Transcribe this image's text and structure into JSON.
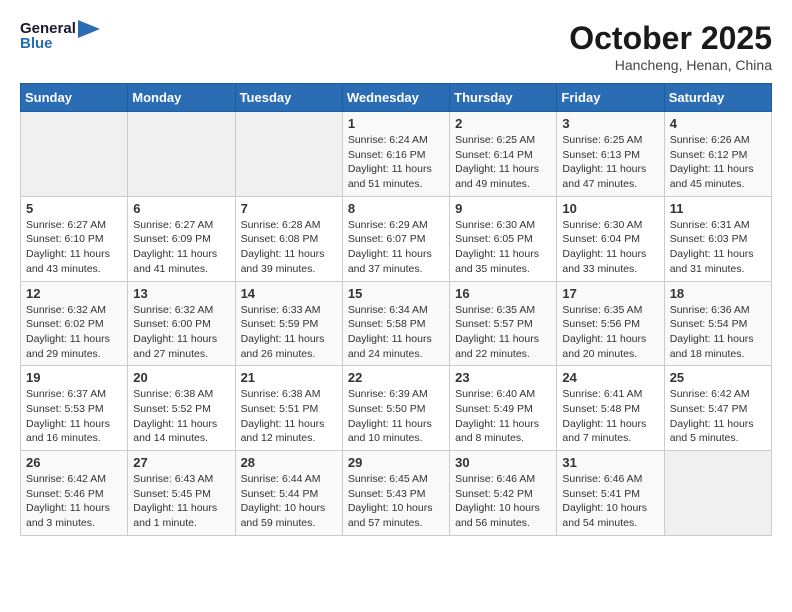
{
  "logo": {
    "line1": "General",
    "line2": "Blue"
  },
  "title": "October 2025",
  "location": "Hancheng, Henan, China",
  "days_header": [
    "Sunday",
    "Monday",
    "Tuesday",
    "Wednesday",
    "Thursday",
    "Friday",
    "Saturday"
  ],
  "weeks": [
    [
      {
        "day": "",
        "info": ""
      },
      {
        "day": "",
        "info": ""
      },
      {
        "day": "",
        "info": ""
      },
      {
        "day": "1",
        "info": "Sunrise: 6:24 AM\nSunset: 6:16 PM\nDaylight: 11 hours\nand 51 minutes."
      },
      {
        "day": "2",
        "info": "Sunrise: 6:25 AM\nSunset: 6:14 PM\nDaylight: 11 hours\nand 49 minutes."
      },
      {
        "day": "3",
        "info": "Sunrise: 6:25 AM\nSunset: 6:13 PM\nDaylight: 11 hours\nand 47 minutes."
      },
      {
        "day": "4",
        "info": "Sunrise: 6:26 AM\nSunset: 6:12 PM\nDaylight: 11 hours\nand 45 minutes."
      }
    ],
    [
      {
        "day": "5",
        "info": "Sunrise: 6:27 AM\nSunset: 6:10 PM\nDaylight: 11 hours\nand 43 minutes."
      },
      {
        "day": "6",
        "info": "Sunrise: 6:27 AM\nSunset: 6:09 PM\nDaylight: 11 hours\nand 41 minutes."
      },
      {
        "day": "7",
        "info": "Sunrise: 6:28 AM\nSunset: 6:08 PM\nDaylight: 11 hours\nand 39 minutes."
      },
      {
        "day": "8",
        "info": "Sunrise: 6:29 AM\nSunset: 6:07 PM\nDaylight: 11 hours\nand 37 minutes."
      },
      {
        "day": "9",
        "info": "Sunrise: 6:30 AM\nSunset: 6:05 PM\nDaylight: 11 hours\nand 35 minutes."
      },
      {
        "day": "10",
        "info": "Sunrise: 6:30 AM\nSunset: 6:04 PM\nDaylight: 11 hours\nand 33 minutes."
      },
      {
        "day": "11",
        "info": "Sunrise: 6:31 AM\nSunset: 6:03 PM\nDaylight: 11 hours\nand 31 minutes."
      }
    ],
    [
      {
        "day": "12",
        "info": "Sunrise: 6:32 AM\nSunset: 6:02 PM\nDaylight: 11 hours\nand 29 minutes."
      },
      {
        "day": "13",
        "info": "Sunrise: 6:32 AM\nSunset: 6:00 PM\nDaylight: 11 hours\nand 27 minutes."
      },
      {
        "day": "14",
        "info": "Sunrise: 6:33 AM\nSunset: 5:59 PM\nDaylight: 11 hours\nand 26 minutes."
      },
      {
        "day": "15",
        "info": "Sunrise: 6:34 AM\nSunset: 5:58 PM\nDaylight: 11 hours\nand 24 minutes."
      },
      {
        "day": "16",
        "info": "Sunrise: 6:35 AM\nSunset: 5:57 PM\nDaylight: 11 hours\nand 22 minutes."
      },
      {
        "day": "17",
        "info": "Sunrise: 6:35 AM\nSunset: 5:56 PM\nDaylight: 11 hours\nand 20 minutes."
      },
      {
        "day": "18",
        "info": "Sunrise: 6:36 AM\nSunset: 5:54 PM\nDaylight: 11 hours\nand 18 minutes."
      }
    ],
    [
      {
        "day": "19",
        "info": "Sunrise: 6:37 AM\nSunset: 5:53 PM\nDaylight: 11 hours\nand 16 minutes."
      },
      {
        "day": "20",
        "info": "Sunrise: 6:38 AM\nSunset: 5:52 PM\nDaylight: 11 hours\nand 14 minutes."
      },
      {
        "day": "21",
        "info": "Sunrise: 6:38 AM\nSunset: 5:51 PM\nDaylight: 11 hours\nand 12 minutes."
      },
      {
        "day": "22",
        "info": "Sunrise: 6:39 AM\nSunset: 5:50 PM\nDaylight: 11 hours\nand 10 minutes."
      },
      {
        "day": "23",
        "info": "Sunrise: 6:40 AM\nSunset: 5:49 PM\nDaylight: 11 hours\nand 8 minutes."
      },
      {
        "day": "24",
        "info": "Sunrise: 6:41 AM\nSunset: 5:48 PM\nDaylight: 11 hours\nand 7 minutes."
      },
      {
        "day": "25",
        "info": "Sunrise: 6:42 AM\nSunset: 5:47 PM\nDaylight: 11 hours\nand 5 minutes."
      }
    ],
    [
      {
        "day": "26",
        "info": "Sunrise: 6:42 AM\nSunset: 5:46 PM\nDaylight: 11 hours\nand 3 minutes."
      },
      {
        "day": "27",
        "info": "Sunrise: 6:43 AM\nSunset: 5:45 PM\nDaylight: 11 hours\nand 1 minute."
      },
      {
        "day": "28",
        "info": "Sunrise: 6:44 AM\nSunset: 5:44 PM\nDaylight: 10 hours\nand 59 minutes."
      },
      {
        "day": "29",
        "info": "Sunrise: 6:45 AM\nSunset: 5:43 PM\nDaylight: 10 hours\nand 57 minutes."
      },
      {
        "day": "30",
        "info": "Sunrise: 6:46 AM\nSunset: 5:42 PM\nDaylight: 10 hours\nand 56 minutes."
      },
      {
        "day": "31",
        "info": "Sunrise: 6:46 AM\nSunset: 5:41 PM\nDaylight: 10 hours\nand 54 minutes."
      },
      {
        "day": "",
        "info": ""
      }
    ]
  ]
}
